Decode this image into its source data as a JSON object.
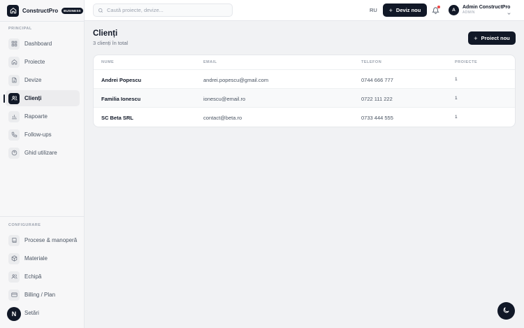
{
  "brand": {
    "name": "ConstructPro",
    "badge": "BUSINESS",
    "logo_icon": "home-icon"
  },
  "sidebar": {
    "section_principal": "PRINCIPAL",
    "principal_items": [
      {
        "label": "Dashboard",
        "icon": "grid-icon"
      },
      {
        "label": "Proiecte",
        "icon": "home-icon"
      },
      {
        "label": "Devize",
        "icon": "document-icon"
      },
      {
        "label": "Clienți",
        "icon": "users-icon",
        "active": true
      },
      {
        "label": "Rapoarte",
        "icon": "bar-chart-icon"
      },
      {
        "label": "Follow-ups",
        "icon": "phone-icon"
      },
      {
        "label": "Ghid utilizare",
        "icon": "help-circle-icon"
      }
    ],
    "section_configurare": "CONFIGURARE",
    "config_items": [
      {
        "label": "Procese & manoperă",
        "icon": "book-icon"
      },
      {
        "label": "Materiale",
        "icon": "box-icon"
      },
      {
        "label": "Echipă",
        "icon": "team-icon"
      },
      {
        "label": "Billing / Plan",
        "icon": "card-icon"
      },
      {
        "label": "Setări",
        "icon": "settings-icon"
      }
    ],
    "n_badge": "N"
  },
  "topbar": {
    "search_placeholder": "Caută proiecte, devize...",
    "language": "RU",
    "new_quote_label": "Deviz nou",
    "user_initial": "A",
    "user_name": "Admin ConstructPro",
    "user_role": "ADMIN"
  },
  "main": {
    "title": "Clienți",
    "subtitle": "3 clienți în total",
    "new_project_label": "Proiect nou",
    "table": {
      "headers": {
        "name": "NUME",
        "email": "EMAIL",
        "phone": "TELEFON",
        "projects": "PROIECTE"
      },
      "rows": [
        {
          "name": "Andrei Popescu",
          "email": "andrei.popescu@gmail.com",
          "phone": "0744 666 777",
          "projects": "1"
        },
        {
          "name": "Familia Ionescu",
          "email": "ionescu@email.ro",
          "phone": "0722 111 222",
          "projects": "1"
        },
        {
          "name": "SC Beta SRL",
          "email": "contact@beta.ro",
          "phone": "0733 444 555",
          "projects": "1"
        }
      ]
    }
  },
  "colors": {
    "primary": "#111827",
    "notification": "#ef4444",
    "background": "#f1f2f4"
  }
}
